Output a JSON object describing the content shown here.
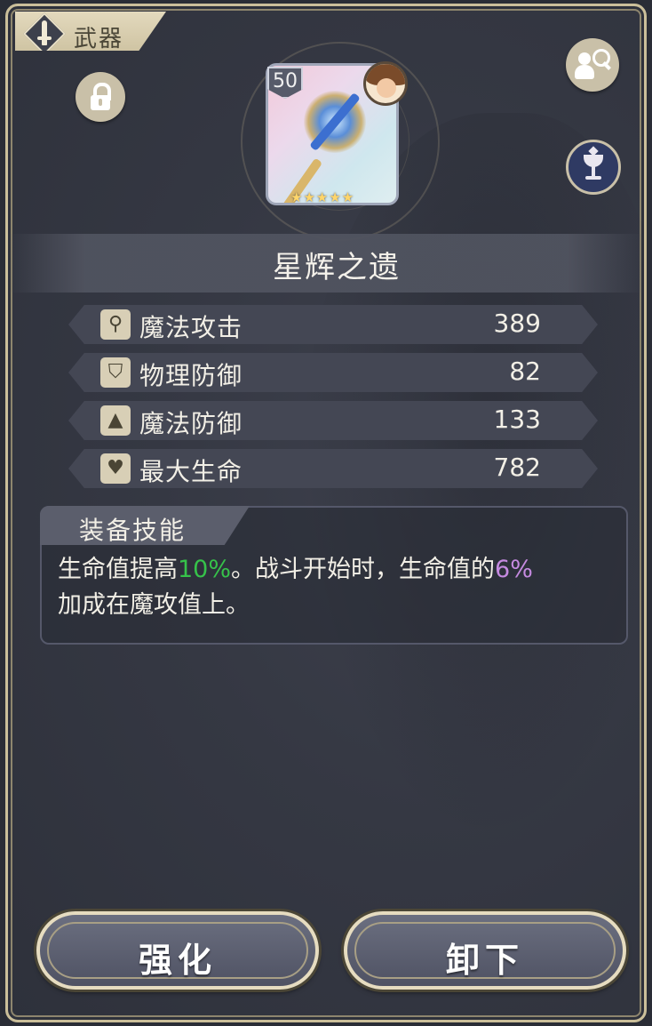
{
  "header": {
    "category_label": "武器",
    "category_icon": "sword-icon"
  },
  "weapon": {
    "level": "50",
    "name": "星辉之遗",
    "stars": "★★★★★",
    "star_count": 5
  },
  "stats": [
    {
      "icon": "wand-icon",
      "label": "魔法攻击",
      "value": "389"
    },
    {
      "icon": "shield-icon",
      "label": "物理防御",
      "value": "82"
    },
    {
      "icon": "witch-hat-icon",
      "label": "魔法防御",
      "value": "133"
    },
    {
      "icon": "heart-icon",
      "label": "最大生命",
      "value": "782"
    }
  ],
  "skill": {
    "header": "装备技能",
    "text_part1": "生命值提高",
    "highlight1": "10%",
    "text_part2": "。战斗开始时，生命值的",
    "highlight2": "6%",
    "text_part3": "加成在魔攻值上。",
    "highlight1_color": "#36c24a",
    "highlight2_color": "#c58ae0"
  },
  "buttons": {
    "enhance": "强化",
    "unequip": "卸下"
  },
  "colors": {
    "panel_border": "#cbbf9a",
    "panel_bg": "#353843",
    "chalice_bg": "#2f3a63"
  }
}
